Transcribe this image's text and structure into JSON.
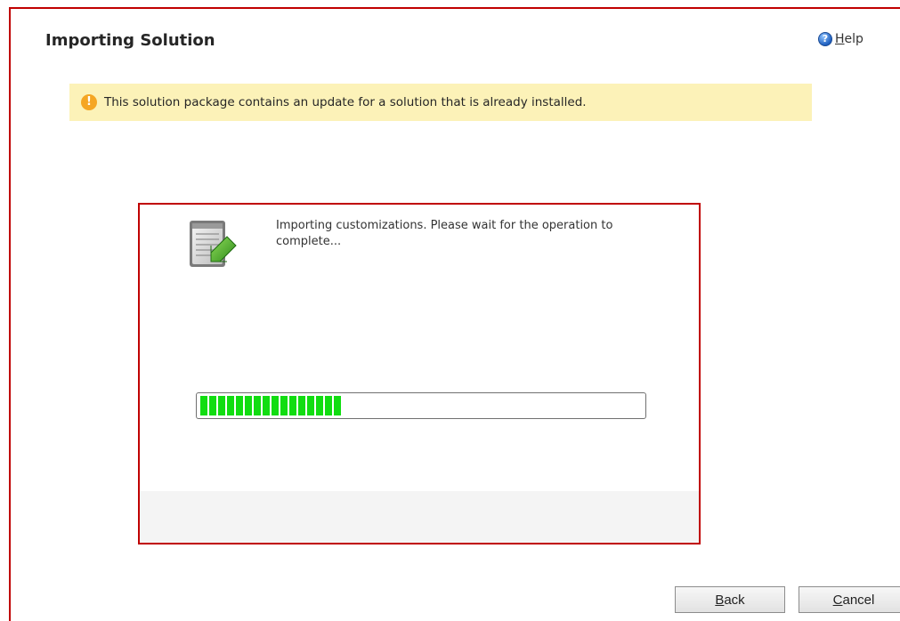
{
  "header": {
    "title": "Importing Solution",
    "help_label": "Help"
  },
  "notice": {
    "text": "This solution package contains an update for a solution that is already installed."
  },
  "dialog": {
    "status_text": "Importing customizations. Please wait for the operation to complete...",
    "progress_percent": 32
  },
  "footer": {
    "back_label": "Back",
    "cancel_label": "Cancel"
  },
  "icons": {
    "help": "help-circle-icon",
    "warning": "warning-exclamation-icon",
    "import": "import-document-arrow-icon"
  },
  "colors": {
    "accent_red": "#c00000",
    "notice_bg": "#fcf2b8",
    "progress_green": "#11dd11",
    "warning_orange": "#f5a623"
  }
}
